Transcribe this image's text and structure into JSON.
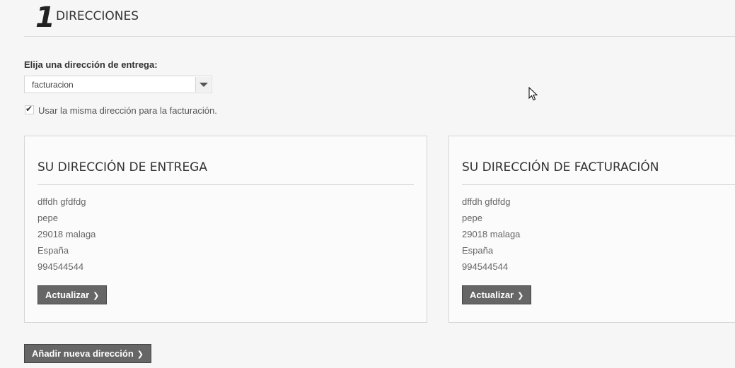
{
  "step": {
    "number": "1",
    "title": "DIRECCIONES"
  },
  "delivery_select": {
    "label": "Elija una dirección de entrega:",
    "value": "facturacion"
  },
  "same_address": {
    "checked": true,
    "label": "Usar la misma dirección para la facturación."
  },
  "cards": {
    "delivery": {
      "title": "SU DIRECCIÓN DE ENTREGA",
      "lines": [
        "dffdh gfdfdg",
        "pepe",
        "29018 malaga",
        "España",
        "994544544"
      ],
      "button": "Actualizar"
    },
    "billing": {
      "title": "SU DIRECCIÓN DE FACTURACIÓN",
      "lines": [
        "dffdh gfdfdg",
        "pepe",
        "29018 malaga",
        "España",
        "994544544"
      ],
      "button": "Actualizar"
    }
  },
  "add_button": "Añadir nueva dirección",
  "icons": {
    "chevron": "chevron-right-icon",
    "checkmark": "check-icon",
    "dropdown": "caret-down-icon",
    "cursor": "mouse-pointer-icon"
  },
  "colors": {
    "button_bg": "#666666",
    "panel_border": "#d6d6d6"
  }
}
